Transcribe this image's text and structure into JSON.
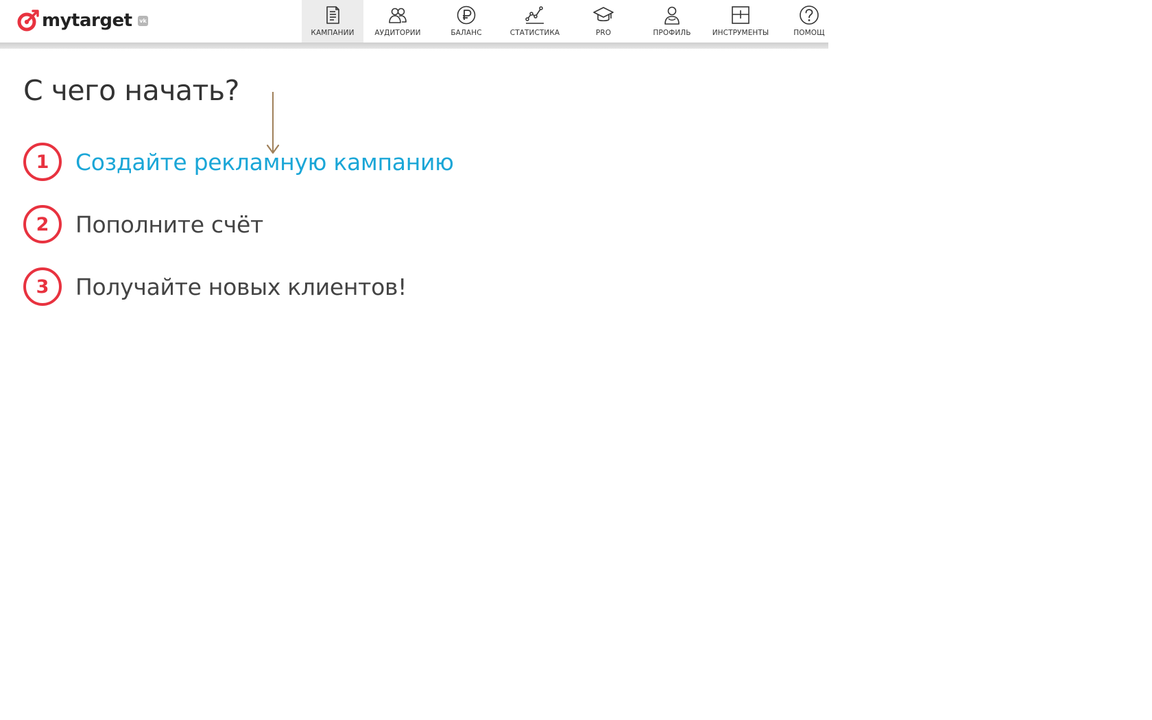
{
  "header": {
    "brand": "mytarget",
    "badge": "vk",
    "nav": [
      {
        "key": "campaigns",
        "label": "КАМПАНИИ",
        "icon": "campaigns-icon",
        "active": true
      },
      {
        "key": "audiences",
        "label": "АУДИТОРИИ",
        "icon": "audiences-icon",
        "active": false
      },
      {
        "key": "balance",
        "label": "БАЛАНС",
        "icon": "ruble-icon",
        "active": false
      },
      {
        "key": "statistics",
        "label": "СТАТИСТИКА",
        "icon": "statistics-chart-icon",
        "active": false
      },
      {
        "key": "pro",
        "label": "PRO",
        "icon": "graduation-cap-icon",
        "active": false
      },
      {
        "key": "profile",
        "label": "ПРОФИЛЬ",
        "icon": "profile-icon",
        "active": false
      },
      {
        "key": "tools",
        "label": "ИНСТРУМЕНТЫ",
        "icon": "tools-icon",
        "active": false
      },
      {
        "key": "help",
        "label": "ПОМОЩ",
        "icon": "help-icon",
        "active": false
      }
    ]
  },
  "main": {
    "title": "С чего начать?",
    "steps": [
      {
        "number": "1",
        "text": "Создайте рекламную кампанию",
        "link": true
      },
      {
        "number": "2",
        "text": "Пополните счёт",
        "link": false
      },
      {
        "number": "3",
        "text": "Получайте новых клиентов!",
        "link": false
      }
    ]
  },
  "colors": {
    "accent_red": "#e8323f",
    "link_blue": "#1aa6d7",
    "annotation_arrow": "#a0805a",
    "active_tab_bg": "#ececec"
  }
}
